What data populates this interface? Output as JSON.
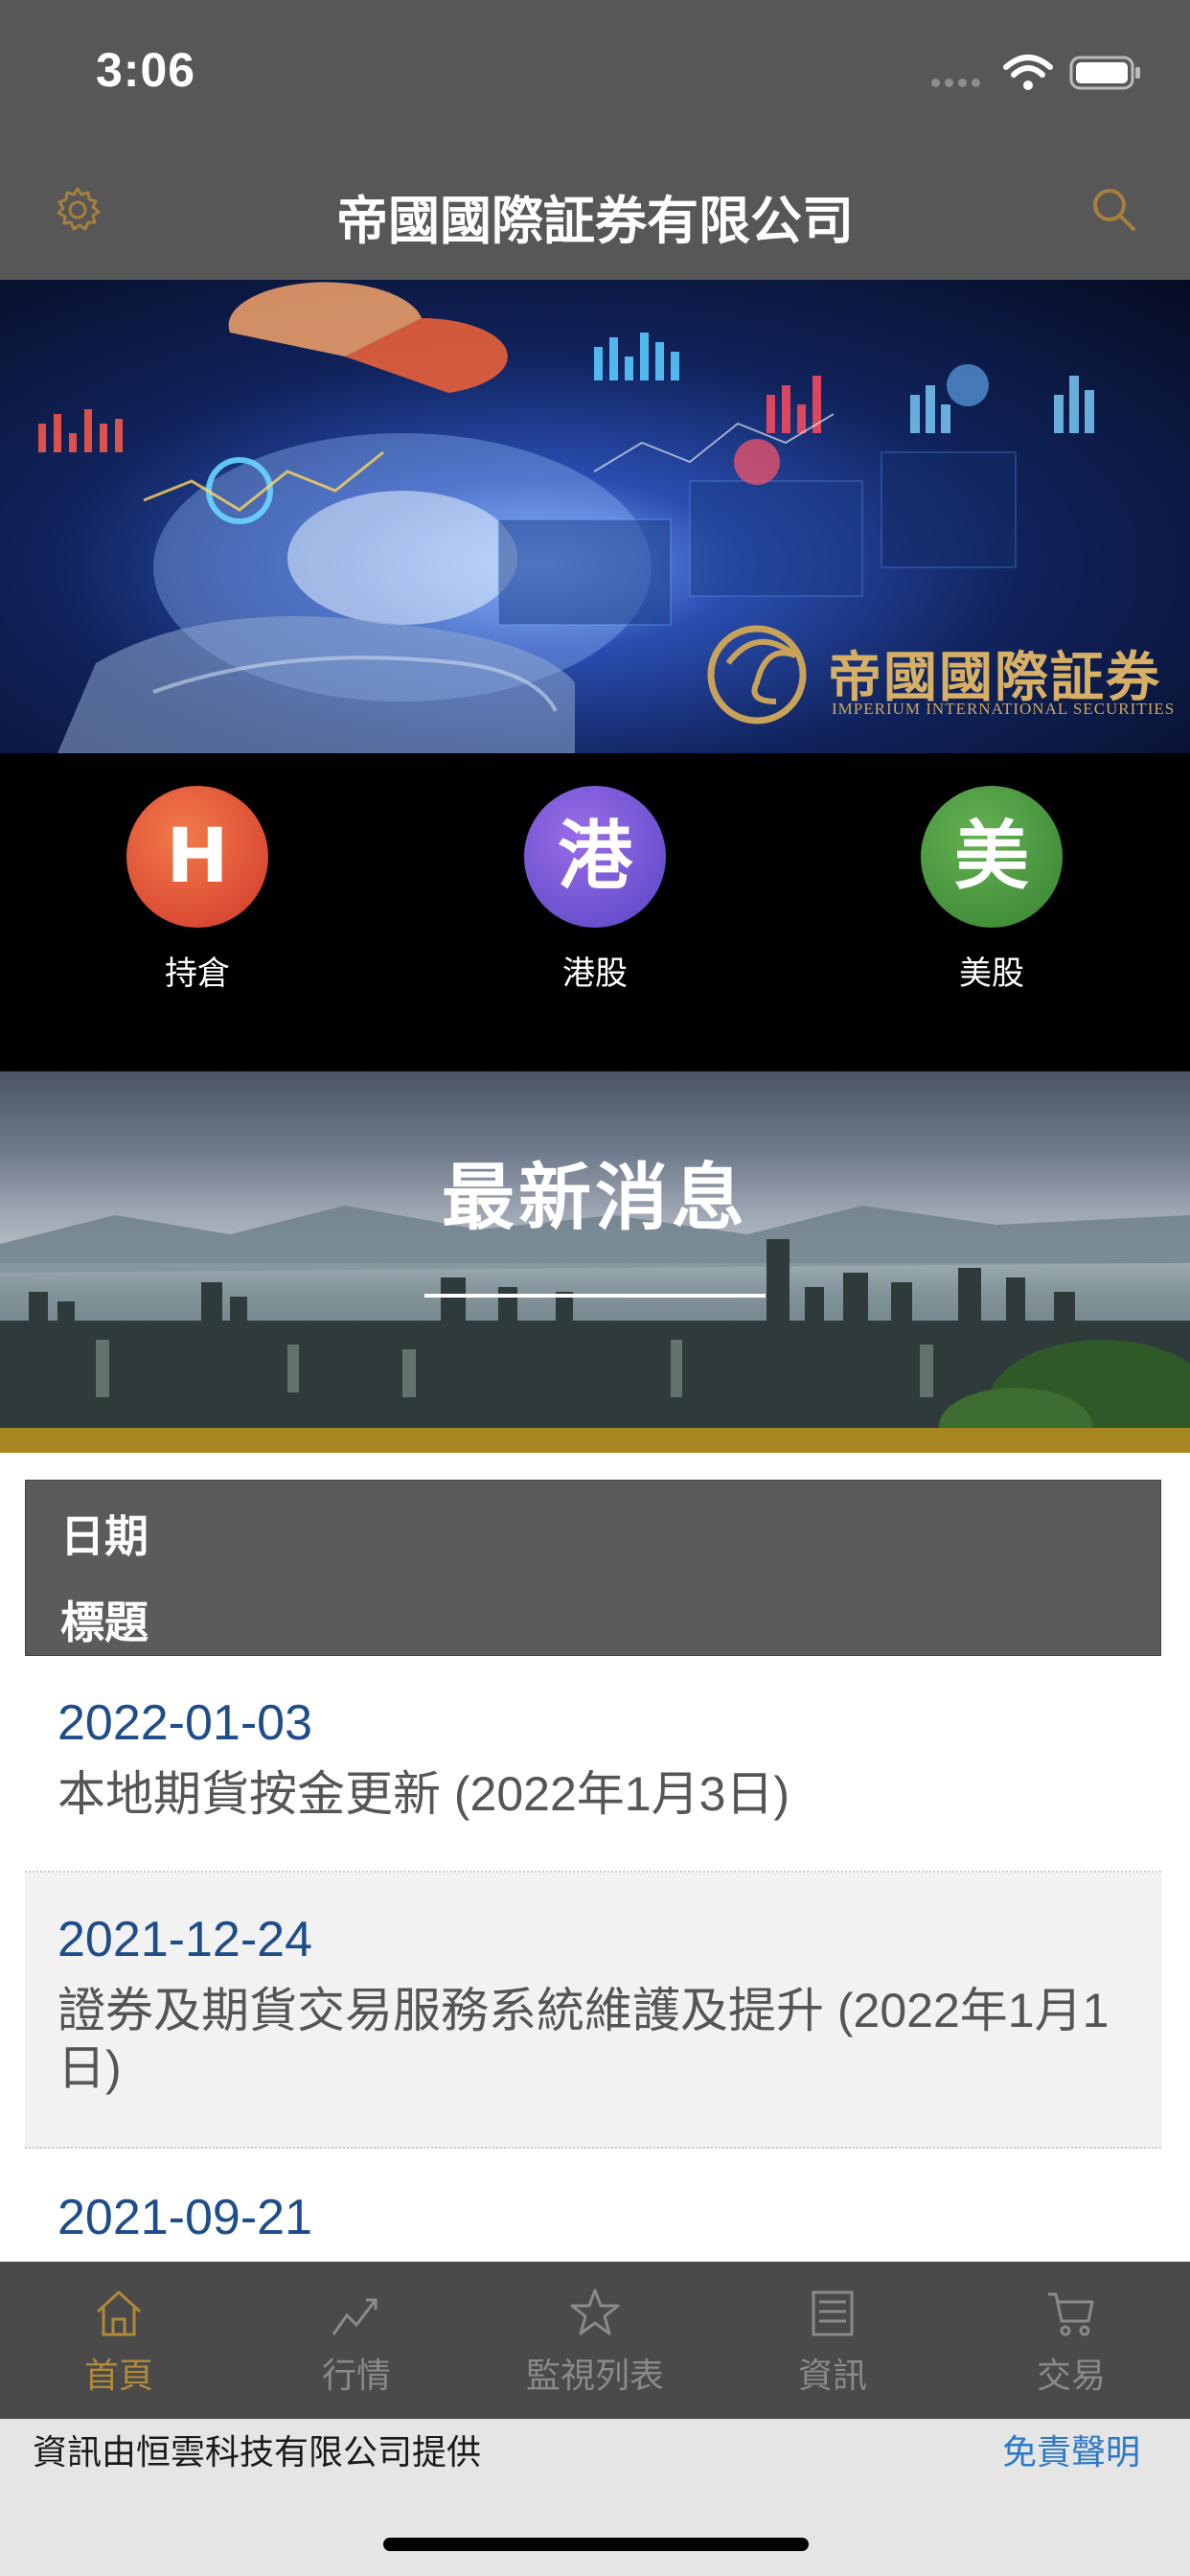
{
  "status_bar": {
    "time": "3:06"
  },
  "header": {
    "title": "帝國國際証券有限公司"
  },
  "hero": {
    "brand_zh": "帝國國際証券",
    "brand_en": "IMPERIUM INTERNATIONAL SECURITIES"
  },
  "quick_links": [
    {
      "icon_text": "H",
      "label": "持倉",
      "color_from": "#f0643c",
      "color_to": "#cf3a2a"
    },
    {
      "icon_text": "港",
      "label": "港股",
      "color_from": "#8a60e0",
      "color_to": "#5b4ec8"
    },
    {
      "icon_text": "美",
      "label": "美股",
      "color_from": "#5aa74a",
      "color_to": "#3e8a36"
    }
  ],
  "news": {
    "banner_title": "最新消息",
    "header_date": "日期",
    "header_title": "標題",
    "items": [
      {
        "date": "2022-01-03",
        "title": "本地期貨按金更新 (2022年1月3日)"
      },
      {
        "date": "2021-12-24",
        "title": "證券及期貨交易服務系統維護及提升 (2022年1月1日)"
      },
      {
        "date": "2021-09-21",
        "title": ""
      }
    ]
  },
  "tabs": [
    {
      "label": "首頁",
      "icon": "home-icon",
      "active": true
    },
    {
      "label": "行情",
      "icon": "chart-icon",
      "active": false
    },
    {
      "label": "監視列表",
      "icon": "star-icon",
      "active": false
    },
    {
      "label": "資訊",
      "icon": "news-icon",
      "active": false
    },
    {
      "label": "交易",
      "icon": "cart-icon",
      "active": false
    }
  ],
  "footer": {
    "provider": "資訊由恒雲科技有限公司提供",
    "disclaimer": "免責聲明"
  },
  "colors": {
    "accent_gold": "#b08a3a",
    "link_blue": "#1e4d8a",
    "header_gray": "#575757"
  }
}
